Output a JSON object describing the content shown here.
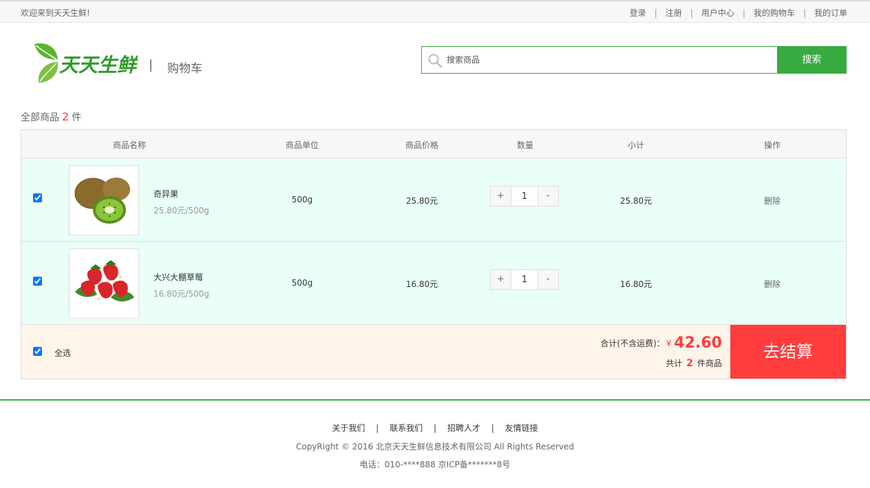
{
  "topbar": {
    "welcome": "欢迎来到天天生鲜!",
    "links": [
      "登录",
      "注册",
      "用户中心",
      "我的购物车",
      "我的订单"
    ]
  },
  "header": {
    "logo_text": "天天生鲜",
    "page_title": "购物车",
    "search_placeholder": "搜索商品",
    "search_button": "搜索"
  },
  "cart": {
    "total_label_prefix": "全部商品",
    "total_count": "2",
    "total_label_suffix": "件",
    "columns": [
      "商品名称",
      "商品单位",
      "商品价格",
      "数量",
      "小计",
      "操作"
    ],
    "items": [
      {
        "name": "奇异果",
        "unit_price": "25.80元/500g",
        "unit": "500g",
        "price": "25.80元",
        "quantity": "1",
        "subtotal": "25.80元",
        "action": "删除",
        "checked": true,
        "image": "kiwi-image"
      },
      {
        "name": "大兴大棚草莓",
        "unit_price": "16.80元/500g",
        "unit": "500g",
        "price": "16.80元",
        "quantity": "1",
        "subtotal": "16.80元",
        "action": "删除",
        "checked": true,
        "image": "strawberry-image"
      }
    ],
    "qty_plus": "+",
    "qty_minus": "-",
    "select_all_label": "全选",
    "total_text": "合计(不含运费)：",
    "currency": "¥",
    "total_amount": "42.60",
    "count_prefix": "共计",
    "count_value": "2",
    "count_suffix": "件商品",
    "checkout_label": "去结算"
  },
  "footer": {
    "links": [
      "关于我们",
      "联系我们",
      "招聘人才",
      "友情链接"
    ],
    "copyright": "CopyRight © 2016 北京天天生鲜信息技术有限公司 All Rights Reserved",
    "contact": "电话：010-****888 京ICP备*******8号"
  },
  "colors": {
    "brand_green": "#37ab40",
    "accent_red": "#ff3d3d",
    "row_bg": "#eafff5",
    "footer_bg": "#fff4ea"
  }
}
